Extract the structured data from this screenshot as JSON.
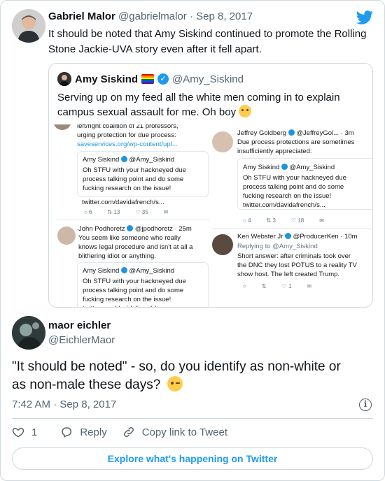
{
  "tweet": {
    "author_name": "Gabriel Malor",
    "handle": "@gabrielmalor",
    "dot": "·",
    "date": "Sep 8, 2017",
    "text_line1": "It should be noted that Amy Siskind continued to promote the Rolling",
    "text_line2": "Stone Jackie-UVA story even after it fell apart."
  },
  "quote": {
    "author_name": "Amy Siskind",
    "handle": "@Amy_Siskind",
    "text_line1": "Serving up on my feed all the white men coming in to explain",
    "text_line2": "campus sexual assault for me. Oh boy"
  },
  "screenshot": {
    "left_top_line1": "left/right coalition of 21 professors,",
    "left_top_line2": "urging protection for due process:",
    "left_top_link": "saveservices.org/wp-content/upl...",
    "amy_name": "Amy Siskind",
    "amy_handle": "@Amy_Siskind",
    "amy_text_line1": "Oh STFU with your hackneyed due",
    "amy_text_line2": "process talking point and do some",
    "amy_text_line3": "fucking research on the issue!",
    "amy_link": "twitter.com/davidafrench/s...",
    "left_counts": [
      "6",
      "13",
      "35"
    ],
    "podhoretz_name": "John Podhoretz",
    "podhoretz_handle": "@jpodhoretz · 25m",
    "podhoretz_line1": "You seem like someone who really",
    "podhoretz_line2": "knows legal procedure and isn't at all a",
    "podhoretz_line3": "blithering idiot or anything.",
    "goldberg_name": "Jeffrey Goldberg",
    "goldberg_handle": "@JeffreyGol... · 3m",
    "goldberg_line1": "Due process protections are sometimes",
    "goldberg_line2": "insufficiently appreciated:",
    "right_counts": [
      "4",
      "3",
      "18"
    ],
    "webster_name": "Ken Webster Jr",
    "webster_handle": "@ProducerKen · 10m",
    "webster_replying": "Replying to",
    "webster_replying_handle": "@Amy_Siskind",
    "webster_line1": "Short answer: after criminals took over",
    "webster_line2": "the DNC they lost POTUS to a reality TV",
    "webster_line3": "show host.  The left created Trump.",
    "webster_like": "1"
  },
  "reply": {
    "author_name": "maor eichler",
    "handle": "@EichlerMaor",
    "text_line1": "\"It should be noted\" - so, do you identify as non-white or",
    "text_line2": "as non-male these days?",
    "time": "7:42 AM · Sep 8, 2017",
    "like_count": "1",
    "reply_label": "Reply",
    "copy_link_label": "Copy link to Tweet",
    "explore_label": "Explore what's happening on Twitter"
  },
  "colors": {
    "twitter_blue": "#1d9bf0",
    "text_primary": "#0f1419",
    "text_secondary": "#536471",
    "border": "#cfd9de"
  },
  "icons": [
    "twitter-bird-icon",
    "verified-badge-icon",
    "rainbow-flag-icon",
    "thinking-face-emoji",
    "winking-face-emoji",
    "info-icon",
    "heart-icon",
    "reply-icon",
    "link-icon"
  ]
}
